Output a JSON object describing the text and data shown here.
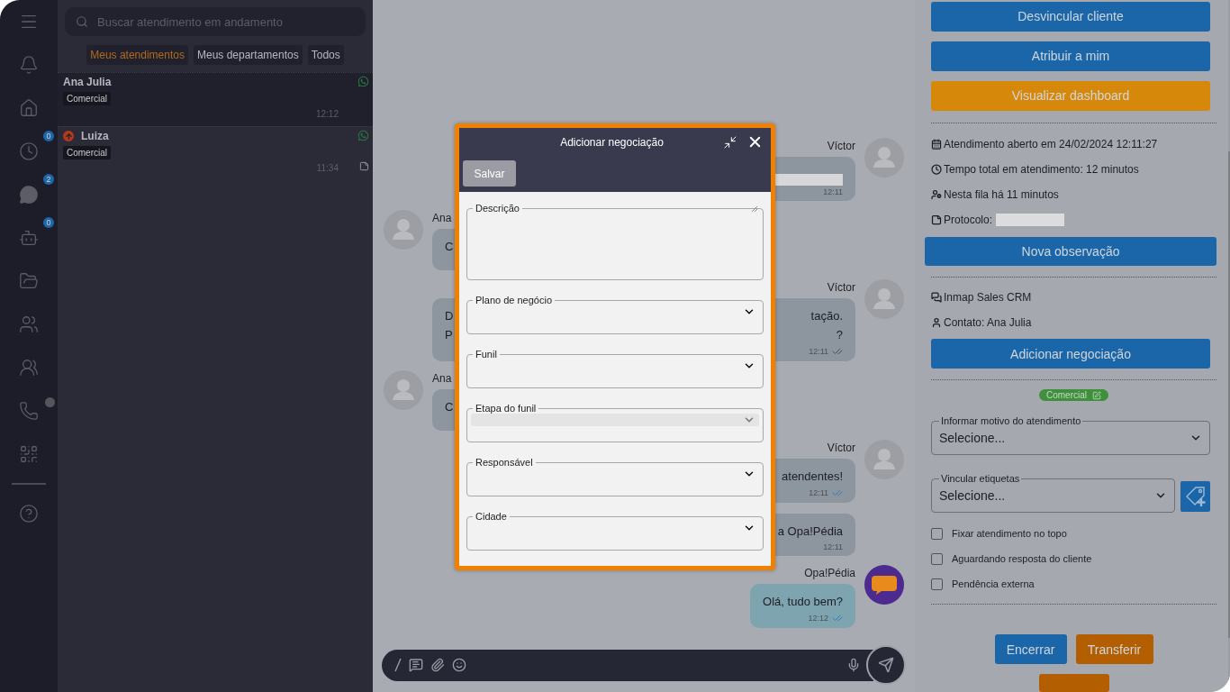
{
  "nav": {
    "items": [
      {
        "kind": "menu"
      },
      {
        "kind": "bell"
      },
      {
        "kind": "home"
      },
      {
        "kind": "clock",
        "badge": "0"
      },
      {
        "kind": "chat",
        "badge": "2"
      },
      {
        "kind": "robot",
        "badge": "0"
      },
      {
        "kind": "folder"
      },
      {
        "kind": "users"
      },
      {
        "kind": "group"
      },
      {
        "kind": "phone",
        "status_dot": true
      },
      {
        "kind": "qr"
      },
      {
        "kind": "divider"
      },
      {
        "kind": "help"
      }
    ]
  },
  "conversations": {
    "search": {
      "placeholder": "Buscar atendimento em andamento"
    },
    "filters": [
      {
        "label": "Meus atendimentos",
        "selected": true
      },
      {
        "label": "Meus departamentos",
        "selected": false
      },
      {
        "label": "Todos",
        "selected": false
      }
    ],
    "items": [
      {
        "name": "Ana Julia",
        "department": "Comercial",
        "time": "12:12",
        "selected": true,
        "urgent": false,
        "has_note": false
      },
      {
        "name": "Luiza",
        "department": "Comercial",
        "time": "11:34",
        "selected": false,
        "urgent": true,
        "has_note": true
      }
    ]
  },
  "chat": {
    "messages": [
      {
        "kind": "outgoing",
        "sender": "Víctor",
        "avatar": true,
        "redacted": true,
        "time": "12:11"
      },
      {
        "kind": "incoming",
        "sender": "Ana",
        "avatar": true,
        "lines": [
          {
            "start": "C"
          }
        ]
      },
      {
        "kind": "outgoing",
        "sender": "Víctor",
        "avatar": true,
        "lines": [
          {
            "start": "D",
            "end": "tação."
          },
          {
            "start": "P",
            "end": "?"
          }
        ],
        "time": "12:11",
        "read": false
      },
      {
        "kind": "incoming",
        "sender": "Ana",
        "avatar": true,
        "lines": [
          {
            "start": "C"
          }
        ]
      },
      {
        "kind": "outgoing",
        "sender": "Víctor",
        "avatar": true,
        "lines": [
          {
            "end": "atendentes!"
          }
        ],
        "time": "12:11",
        "read": true
      },
      {
        "kind": "outgoing",
        "avatar": false,
        "lines": [
          {
            "end": "a Opa!Pédia"
          }
        ],
        "time": "12:11"
      },
      {
        "kind": "outgoing",
        "sender": "Opa!Pédia",
        "avatar": true,
        "bot": true,
        "lines": [
          {
            "end": "Olá, tudo bem?"
          }
        ],
        "time": "12:12",
        "read": true
      }
    ]
  },
  "modal": {
    "title": "Adicionar negociação",
    "save_label": "Salvar",
    "fields": [
      {
        "label": "Descrição",
        "kind": "textarea"
      },
      {
        "label": "Plano de negócio",
        "kind": "select",
        "disabled": false
      },
      {
        "label": "Funil",
        "kind": "select",
        "disabled": false
      },
      {
        "label": "Etapa do funil",
        "kind": "select",
        "disabled": true
      },
      {
        "label": "Responsável",
        "kind": "select",
        "disabled": false
      },
      {
        "label": "Cidade",
        "kind": "select",
        "disabled": false
      }
    ]
  },
  "details": {
    "top_buttons": [
      {
        "label": "Desvincular cliente",
        "kind": "primary"
      },
      {
        "label": "Atribuir a mim",
        "kind": "primary"
      },
      {
        "label": "Visualizar dashboard",
        "kind": "warning"
      }
    ],
    "info": [
      {
        "kind": "calendar",
        "text": "Atendimento aberto em 24/02/2024 12:11:27"
      },
      {
        "kind": "clock",
        "text": "Tempo total em atendimento: 12 minutos"
      },
      {
        "kind": "queue",
        "text": "Nesta fila há 11 minutos"
      },
      {
        "kind": "protocol",
        "text": "Protocolo:",
        "redacted": true
      }
    ],
    "note_button": "Nova observação",
    "crm": [
      {
        "kind": "crm",
        "text": "Inmap Sales CRM"
      },
      {
        "kind": "contact",
        "text": "Contato: Ana Julia"
      }
    ],
    "deal_button": "Adicionar negociação",
    "department_tag": {
      "label": "Comercial",
      "color": "#3f8f3c"
    },
    "selects": [
      {
        "label": "Informar motivo do atendimento",
        "value": "Selecione...",
        "add_tag": false
      },
      {
        "label": "Vincular etiquetas",
        "value": "Selecione...",
        "add_tag": true
      }
    ],
    "checkboxes": [
      {
        "label": "Fixar atendimento no topo",
        "checked": false
      },
      {
        "label": "Aguardando resposta do cliente",
        "checked": false
      },
      {
        "label": "Pendência externa",
        "checked": false
      }
    ],
    "bottom_buttons": [
      {
        "label": "Encerrar",
        "kind": "primary"
      },
      {
        "label": "Transferir",
        "kind": "danger"
      }
    ]
  }
}
